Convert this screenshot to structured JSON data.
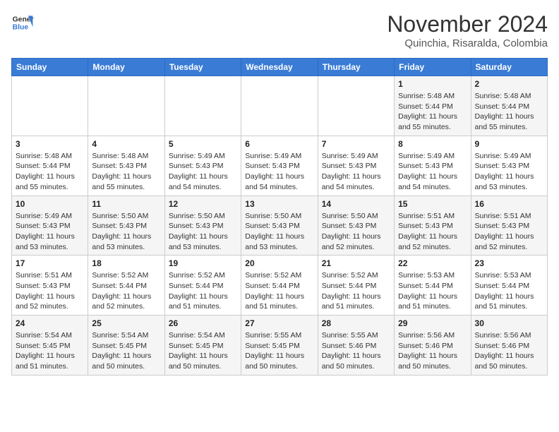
{
  "header": {
    "logo_general": "General",
    "logo_blue": "Blue",
    "month": "November 2024",
    "location": "Quinchia, Risaralda, Colombia"
  },
  "weekdays": [
    "Sunday",
    "Monday",
    "Tuesday",
    "Wednesday",
    "Thursday",
    "Friday",
    "Saturday"
  ],
  "weeks": [
    [
      {
        "day": "",
        "info": ""
      },
      {
        "day": "",
        "info": ""
      },
      {
        "day": "",
        "info": ""
      },
      {
        "day": "",
        "info": ""
      },
      {
        "day": "",
        "info": ""
      },
      {
        "day": "1",
        "info": "Sunrise: 5:48 AM\nSunset: 5:44 PM\nDaylight: 11 hours\nand 55 minutes."
      },
      {
        "day": "2",
        "info": "Sunrise: 5:48 AM\nSunset: 5:44 PM\nDaylight: 11 hours\nand 55 minutes."
      }
    ],
    [
      {
        "day": "3",
        "info": "Sunrise: 5:48 AM\nSunset: 5:44 PM\nDaylight: 11 hours\nand 55 minutes."
      },
      {
        "day": "4",
        "info": "Sunrise: 5:48 AM\nSunset: 5:43 PM\nDaylight: 11 hours\nand 55 minutes."
      },
      {
        "day": "5",
        "info": "Sunrise: 5:49 AM\nSunset: 5:43 PM\nDaylight: 11 hours\nand 54 minutes."
      },
      {
        "day": "6",
        "info": "Sunrise: 5:49 AM\nSunset: 5:43 PM\nDaylight: 11 hours\nand 54 minutes."
      },
      {
        "day": "7",
        "info": "Sunrise: 5:49 AM\nSunset: 5:43 PM\nDaylight: 11 hours\nand 54 minutes."
      },
      {
        "day": "8",
        "info": "Sunrise: 5:49 AM\nSunset: 5:43 PM\nDaylight: 11 hours\nand 54 minutes."
      },
      {
        "day": "9",
        "info": "Sunrise: 5:49 AM\nSunset: 5:43 PM\nDaylight: 11 hours\nand 53 minutes."
      }
    ],
    [
      {
        "day": "10",
        "info": "Sunrise: 5:49 AM\nSunset: 5:43 PM\nDaylight: 11 hours\nand 53 minutes."
      },
      {
        "day": "11",
        "info": "Sunrise: 5:50 AM\nSunset: 5:43 PM\nDaylight: 11 hours\nand 53 minutes."
      },
      {
        "day": "12",
        "info": "Sunrise: 5:50 AM\nSunset: 5:43 PM\nDaylight: 11 hours\nand 53 minutes."
      },
      {
        "day": "13",
        "info": "Sunrise: 5:50 AM\nSunset: 5:43 PM\nDaylight: 11 hours\nand 53 minutes."
      },
      {
        "day": "14",
        "info": "Sunrise: 5:50 AM\nSunset: 5:43 PM\nDaylight: 11 hours\nand 52 minutes."
      },
      {
        "day": "15",
        "info": "Sunrise: 5:51 AM\nSunset: 5:43 PM\nDaylight: 11 hours\nand 52 minutes."
      },
      {
        "day": "16",
        "info": "Sunrise: 5:51 AM\nSunset: 5:43 PM\nDaylight: 11 hours\nand 52 minutes."
      }
    ],
    [
      {
        "day": "17",
        "info": "Sunrise: 5:51 AM\nSunset: 5:43 PM\nDaylight: 11 hours\nand 52 minutes."
      },
      {
        "day": "18",
        "info": "Sunrise: 5:52 AM\nSunset: 5:44 PM\nDaylight: 11 hours\nand 52 minutes."
      },
      {
        "day": "19",
        "info": "Sunrise: 5:52 AM\nSunset: 5:44 PM\nDaylight: 11 hours\nand 51 minutes."
      },
      {
        "day": "20",
        "info": "Sunrise: 5:52 AM\nSunset: 5:44 PM\nDaylight: 11 hours\nand 51 minutes."
      },
      {
        "day": "21",
        "info": "Sunrise: 5:52 AM\nSunset: 5:44 PM\nDaylight: 11 hours\nand 51 minutes."
      },
      {
        "day": "22",
        "info": "Sunrise: 5:53 AM\nSunset: 5:44 PM\nDaylight: 11 hours\nand 51 minutes."
      },
      {
        "day": "23",
        "info": "Sunrise: 5:53 AM\nSunset: 5:44 PM\nDaylight: 11 hours\nand 51 minutes."
      }
    ],
    [
      {
        "day": "24",
        "info": "Sunrise: 5:54 AM\nSunset: 5:45 PM\nDaylight: 11 hours\nand 51 minutes."
      },
      {
        "day": "25",
        "info": "Sunrise: 5:54 AM\nSunset: 5:45 PM\nDaylight: 11 hours\nand 50 minutes."
      },
      {
        "day": "26",
        "info": "Sunrise: 5:54 AM\nSunset: 5:45 PM\nDaylight: 11 hours\nand 50 minutes."
      },
      {
        "day": "27",
        "info": "Sunrise: 5:55 AM\nSunset: 5:45 PM\nDaylight: 11 hours\nand 50 minutes."
      },
      {
        "day": "28",
        "info": "Sunrise: 5:55 AM\nSunset: 5:46 PM\nDaylight: 11 hours\nand 50 minutes."
      },
      {
        "day": "29",
        "info": "Sunrise: 5:56 AM\nSunset: 5:46 PM\nDaylight: 11 hours\nand 50 minutes."
      },
      {
        "day": "30",
        "info": "Sunrise: 5:56 AM\nSunset: 5:46 PM\nDaylight: 11 hours\nand 50 minutes."
      }
    ]
  ]
}
